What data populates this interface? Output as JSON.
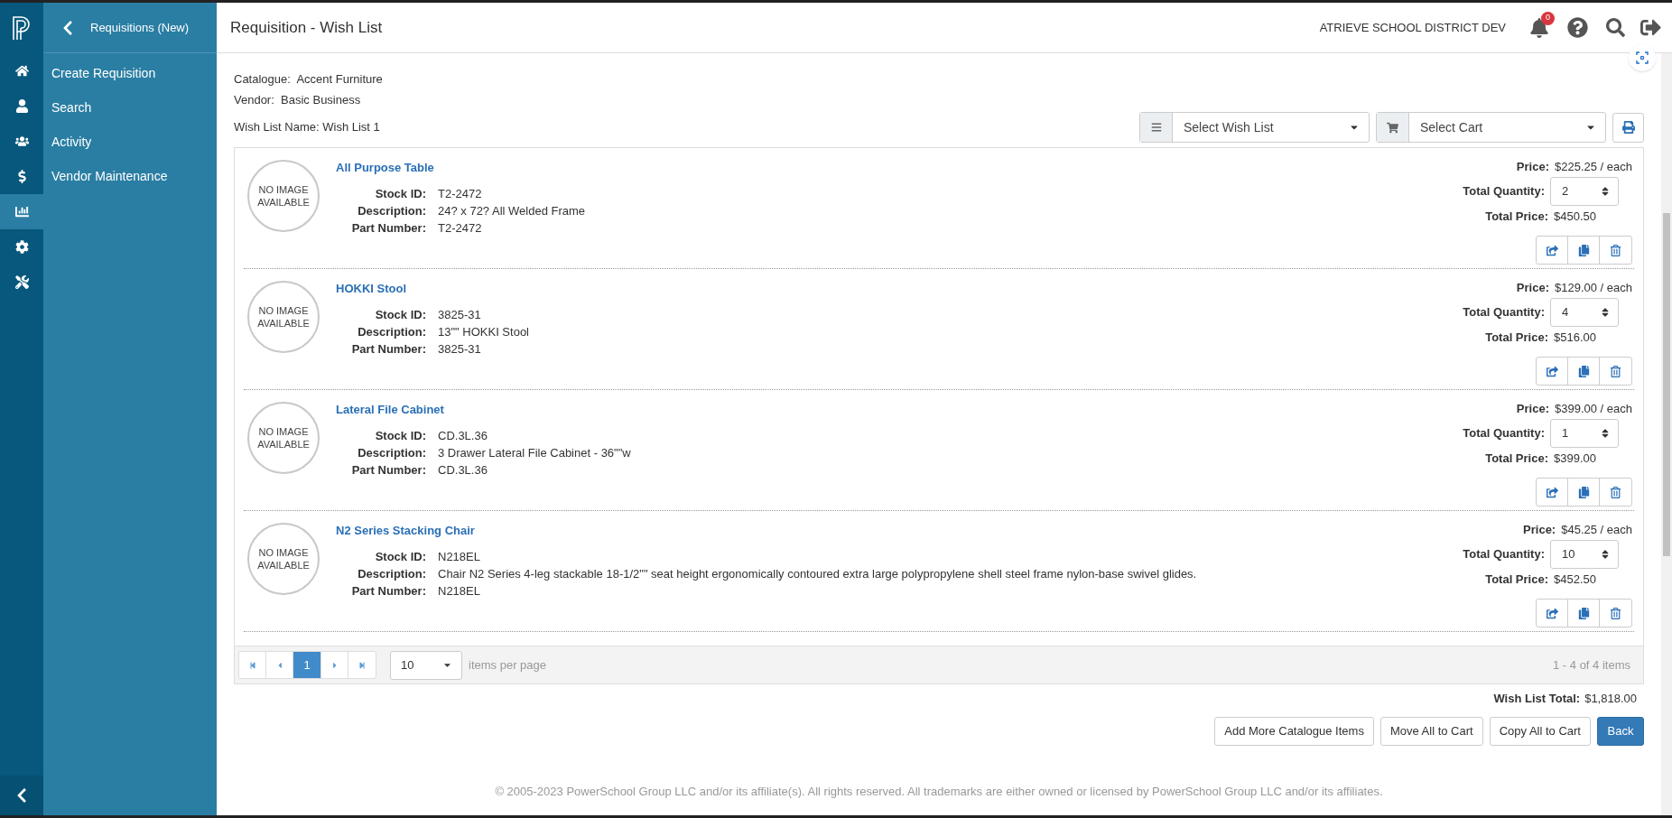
{
  "rail": {
    "items": [
      {
        "kind": "home",
        "selected": false
      },
      {
        "kind": "user",
        "selected": false
      },
      {
        "kind": "users",
        "selected": false
      },
      {
        "kind": "dollar",
        "selected": false
      },
      {
        "kind": "chart",
        "selected": true
      },
      {
        "kind": "gear",
        "selected": false
      },
      {
        "kind": "tools",
        "selected": false
      }
    ]
  },
  "sidebar": {
    "title": "Requisitions (New)",
    "items": [
      "Create Requisition",
      "Search",
      "Activity",
      "Vendor Maintenance"
    ]
  },
  "header": {
    "title": "Requisition - Wish List",
    "district": "ATRIEVE SCHOOL DISTRICT DEV",
    "notifications": "0"
  },
  "info": {
    "catalogue_label": "Catalogue:",
    "catalogue": "Accent Furniture",
    "vendor_label": "Vendor:",
    "vendor": "Basic Business",
    "wish_list_name": "Wish List Name: Wish List 1"
  },
  "wish_list_select": {
    "placeholder": "Select Wish List"
  },
  "cart_select": {
    "placeholder": "Select Cart"
  },
  "items": [
    {
      "image": "NO IMAGE AVAILABLE",
      "name": "All Purpose Table",
      "stock_id_label": "Stock ID:",
      "stock_id": "T2-2472",
      "description_label": "Description:",
      "description": "24? x 72? All Welded Frame",
      "part_number_label": "Part Number:",
      "part_number": "T2-2472",
      "price_label": "Price:",
      "price": "$225.25 / each",
      "quantity_label": "Total Quantity:",
      "quantity": "2",
      "total_price_label": "Total Price:",
      "total_price": "$450.50"
    },
    {
      "image": "NO IMAGE AVAILABLE",
      "name": "HOKKI Stool",
      "stock_id_label": "Stock ID:",
      "stock_id": "3825-31",
      "description_label": "Description:",
      "description": "13\"\" HOKKI Stool",
      "part_number_label": "Part Number:",
      "part_number": "3825-31",
      "price_label": "Price:",
      "price": "$129.00 / each",
      "quantity_label": "Total Quantity:",
      "quantity": "4",
      "total_price_label": "Total Price:",
      "total_price": "$516.00"
    },
    {
      "image": "NO IMAGE AVAILABLE",
      "name": "Lateral File Cabinet",
      "stock_id_label": "Stock ID:",
      "stock_id": "CD.3L.36",
      "description_label": "Description:",
      "description": "3 Drawer Lateral File Cabinet - 36\"\"w",
      "part_number_label": "Part Number:",
      "part_number": "CD.3L.36",
      "price_label": "Price:",
      "price": "$399.00 / each",
      "quantity_label": "Total Quantity:",
      "quantity": "1",
      "total_price_label": "Total Price:",
      "total_price": "$399.00"
    },
    {
      "image": "NO IMAGE AVAILABLE",
      "name": "N2 Series Stacking Chair",
      "stock_id_label": "Stock ID:",
      "stock_id": "N218EL",
      "description_label": "Description:",
      "description": "Chair N2 Series 4-leg stackable 18-1/2\"\" seat height ergonomically contoured extra large polypropylene shell steel frame nylon-base swivel glides.",
      "part_number_label": "Part Number:",
      "part_number": "N218EL",
      "price_label": "Price:",
      "price": "$45.25 / each",
      "quantity_label": "Total Quantity:",
      "quantity": "10",
      "total_price_label": "Total Price:",
      "total_price": "$452.50"
    }
  ],
  "pager": {
    "pages": [
      {
        "label": "1",
        "selected": true
      }
    ],
    "page_size": "10",
    "page_size_label": "items per page",
    "summary": "1 - 4 of 4 items"
  },
  "total": {
    "label": "Wish List Total:",
    "value": "$1,818.00"
  },
  "buttons": [
    {
      "label": "Add More Catalogue Items",
      "primary": false
    },
    {
      "label": "Move All to Cart",
      "primary": false
    },
    {
      "label": "Copy All to Cart",
      "primary": false
    },
    {
      "label": "Back",
      "primary": true
    }
  ],
  "footer": "© 2005-2023 PowerSchool Group LLC and/or its affiliate(s). All rights reserved. All trademarks are either owned or licensed by PowerSchool Group LLC and/or its affiliates."
}
